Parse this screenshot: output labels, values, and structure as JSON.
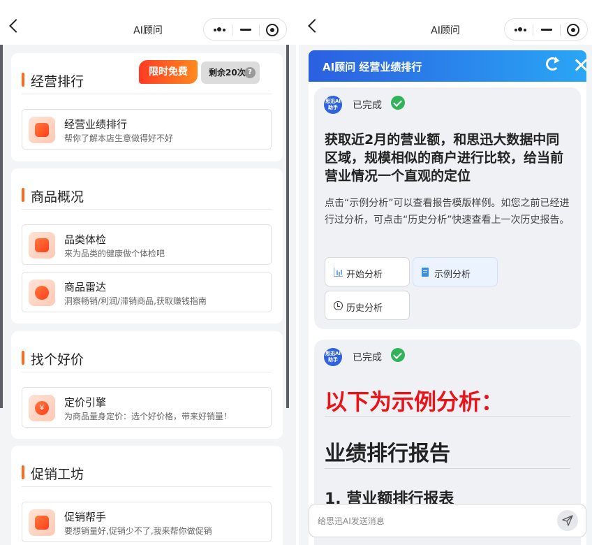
{
  "left": {
    "nav_title": "AI顾问",
    "badge_free": "限时免费",
    "badge_remaining": "剩余20次",
    "badge_help": "?",
    "sections": [
      {
        "title": "经营排行",
        "items": [
          {
            "title": "经营业绩排行",
            "desc": "帮你了解本店生意做得好不好",
            "icon": "bar-chart-icon"
          }
        ]
      },
      {
        "title": "商品概况",
        "items": [
          {
            "title": "品类体检",
            "desc": "来为品类的健康做个体检吧",
            "icon": "list-icon"
          },
          {
            "title": "商品雷达",
            "desc": "洞察畅销/利润/滞销商品,获取赚钱指南",
            "icon": "radar-icon"
          }
        ]
      },
      {
        "title": "找个好价",
        "items": [
          {
            "title": "定价引擎",
            "desc": "为商品量身定价：选个好价格，带来好销量！",
            "icon": "yen-icon",
            "glyph": "¥"
          }
        ]
      },
      {
        "title": "促销工坊",
        "items": [
          {
            "title": "促销帮手",
            "desc": "要想销量好,促销少不了,我来帮你做促销",
            "icon": "tag-icon"
          }
        ]
      }
    ]
  },
  "right": {
    "nav_title": "AI顾问",
    "panel_title": "AI顾问 经营业绩排行",
    "avatar_text": "思迅AI助手",
    "messages": [
      {
        "status": "已完成",
        "heading": "获取近2月的营业额，和思迅大数据中同区域，规模相似的商户进行比较，给当前营业情况一个直观的定位",
        "paragraph": "点击“示例分析”可以查看报告模版样例。如您之前已经进行过分析，可点击“历史分析”快速查看上一次历史报告。",
        "buttons": [
          "开始分析",
          "示例分析",
          "历史分析"
        ]
      },
      {
        "status": "已完成",
        "example_title": "以下为示例分析：",
        "report_title": "业绩排行报告",
        "report_subtitle": "1. 营业额排行报表"
      }
    ],
    "input_placeholder": "给思迅AI发送消息"
  },
  "colors": {
    "accent_orange": "#ff6a1f",
    "header_blue_start": "#2b5fe0",
    "header_blue_end": "#2aa6f5",
    "example_red": "#e8141a",
    "success_green": "#31b35a"
  }
}
